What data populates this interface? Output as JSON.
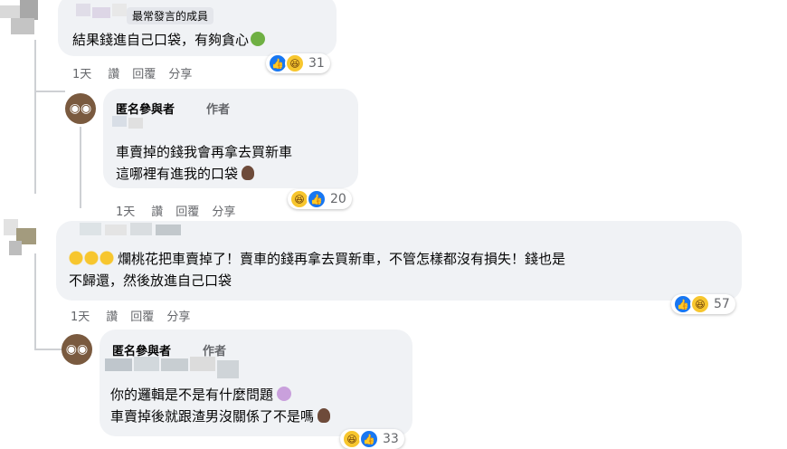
{
  "colors": {
    "bubble": "#f0f2f5",
    "like": "#1877f2",
    "text": "#050505",
    "meta": "#65676b"
  },
  "comments": [
    {
      "id": "c1",
      "badge": "最常發言的成員",
      "lines": [
        "結果錢進自己口袋，有夠貪心"
      ],
      "emoji_end": "nauseated-face-icon",
      "actions": [
        "1天",
        "讚",
        "回覆",
        "分享"
      ],
      "reactions": {
        "types": [
          "like",
          "haha"
        ],
        "count": "31"
      }
    },
    {
      "id": "r1",
      "name": "匿名參與者",
      "author_tag": "作者",
      "lines": [
        "車賣掉的錢我會再拿去買新車",
        "這哪裡有進我的口袋"
      ],
      "emoji_end": "woman-icon",
      "actions": [
        "1天",
        "讚",
        "回覆",
        "分享"
      ],
      "reactions": {
        "types": [
          "haha",
          "like"
        ],
        "count": "20"
      }
    },
    {
      "id": "c2",
      "lines": [
        "爛桃花把車賣掉了！賣車的錢再拿去買新車，不管怎樣都沒有損失！錢也是",
        "不歸還，然後放進自己口袋"
      ],
      "emoji_start": "rolling-laugh-icons",
      "actions": [
        "1天",
        "讚",
        "回覆",
        "分享"
      ],
      "reactions": {
        "types": [
          "like",
          "haha"
        ],
        "count": "57"
      }
    },
    {
      "id": "r2",
      "name": "匿名參與者",
      "author_tag": "作者",
      "lines": [
        "你的邏輯是不是有什麼問題",
        "車賣掉後就跟渣男沒關係了不是嗎"
      ],
      "reactions": {
        "types": [
          "haha",
          "like"
        ],
        "count": "33"
      }
    }
  ]
}
